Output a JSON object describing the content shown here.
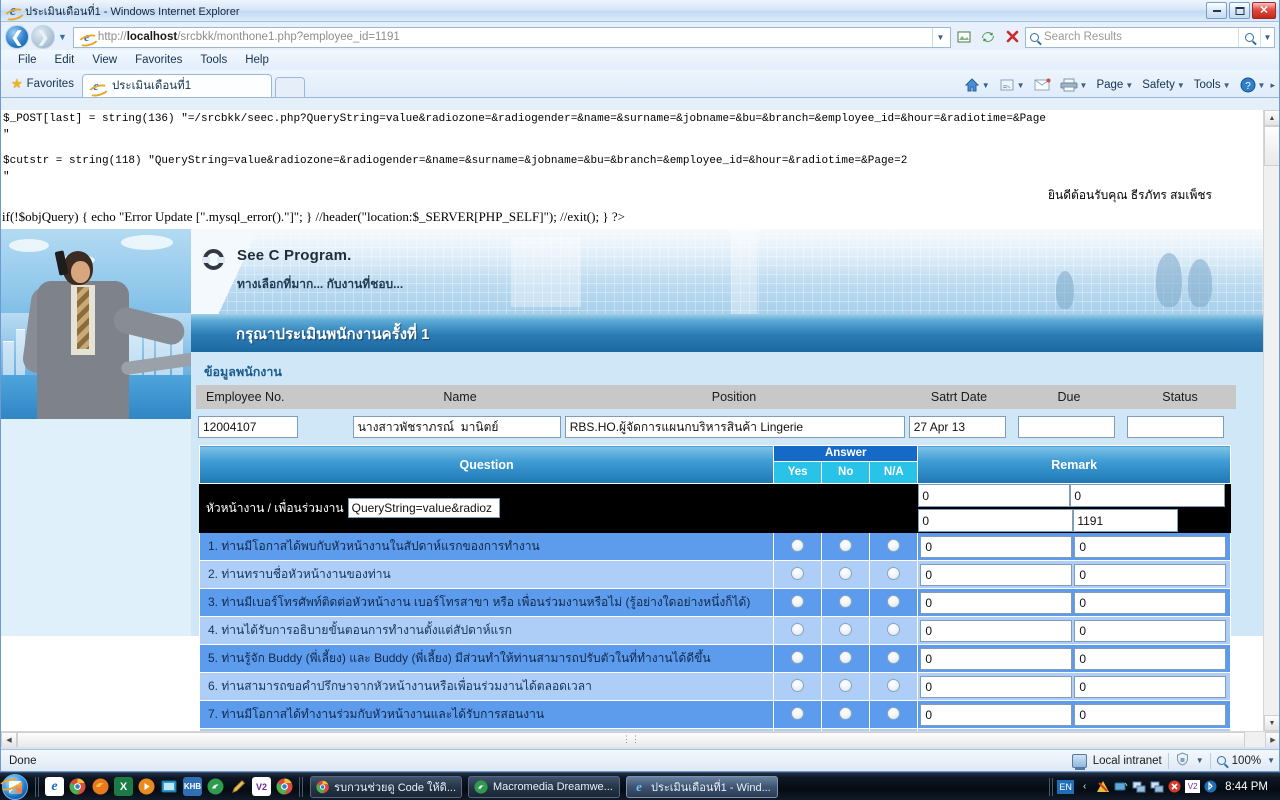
{
  "window": {
    "title": "ประเมินเดือนที่1 - Windows Internet Explorer",
    "minimize_label": "Minimize",
    "maximize_label": "Restore",
    "close_label": "Close"
  },
  "nav": {
    "back_label": "Back",
    "forward_label": "Forward",
    "url_prefix": "http://",
    "url_host": "localhost",
    "url_path": "/srcbkk/monthone1.php?employee_id=1191",
    "refresh_label": "Refresh",
    "stop_label": "Stop",
    "compat_label": "Compatibility View"
  },
  "search": {
    "placeholder": "Search Results",
    "value": ""
  },
  "menubar": {
    "items": [
      "File",
      "Edit",
      "View",
      "Favorites",
      "Tools",
      "Help"
    ]
  },
  "favbar": {
    "favorites_label": "Favorites",
    "tab_title": "ประเมินเดือนที่1",
    "new_tab_label": ""
  },
  "cmdbar": {
    "items": [
      "Page",
      "Safety",
      "Tools"
    ],
    "home_label": "Home",
    "feeds_label": "Feeds",
    "mail_label": "Read mail",
    "print_label": "Print",
    "help_label": "Help"
  },
  "debug": {
    "line1": "$_POST[last] = string(136) \"=/srcbkk/seec.php?QueryString=value&radiozone=&radiogender=&name=&surname=&jobname=&bu=&branch=&employee_id=&hour=&radiotime=&Page",
    "line1b": "\"",
    "line2": "$cutstr = string(118)  \"QueryString=value&radiozone=&radiogender=&name=&surname=&jobname=&bu=&branch=&employee_id=&hour=&radiotime=&Page=2",
    "line2b": "\"",
    "welcome": "ยินดีต้อนรับคุณ ธีรภัทร สมเพ็ชร",
    "line3": "if(!$objQuery) { echo \"Error Update [\".mysql_error().\"]\"; } //header(\"location:$_SERVER[PHP_SELF]\"); //exit(); } ?>"
  },
  "banner": {
    "logo_text": "See C Program.",
    "logo_sub": "ทางเลือกที่มาก... กับงานที่ชอบ...",
    "page_heading": "กรุณาประเมินพนักงานครั้งที่ 1"
  },
  "employee_section": {
    "section_title": "ข้อมูลพนักงาน",
    "columns": [
      "Employee No.",
      "Name",
      "Position",
      "Satrt Date",
      "Due",
      "Status"
    ],
    "values": {
      "employee_no": "12004107",
      "name": "นางสาวพัชราภรณ์  มานิตย์",
      "position": "RBS.HO.ผู้จัดการแผนกบริหารสินค้า Lingerie",
      "start_date": "27 Apr 13",
      "due": "",
      "status": ""
    }
  },
  "question_table": {
    "headers": {
      "question": "Question",
      "answer": "Answer",
      "yes": "Yes",
      "no": "No",
      "na": "N/A",
      "remark": "Remark"
    },
    "black_row": {
      "label": "หัวหน้างาน / เพื่อนร่วมงาน",
      "input_a": "QueryString=value&radioz",
      "input_b": "0",
      "input_c": "0",
      "input_d": "0",
      "input_e": "1191"
    },
    "rows": [
      {
        "text": "1. ท่านมีโอกาสได้พบกับหัวหน้างานในสัปดาห์แรกของการทำงาน",
        "remark1": "0",
        "remark2": "0"
      },
      {
        "text": "2. ท่านทราบชื่อหัวหน้างานของท่าน",
        "remark1": "0",
        "remark2": "0"
      },
      {
        "text": "3. ท่านมีเบอร์โทรศัพท์ติดต่อหัวหน้างาน เบอร์โทรสาขา หรือ เพื่อนร่วมงานหรือไม่ (รู้อย่างใดอย่างหนึ่งก็ได้)",
        "remark1": "0",
        "remark2": "0"
      },
      {
        "text": "4. ท่านได้รับการอธิบายขั้นตอนการทำงานตั้งแต่สัปดาห์แรก",
        "remark1": "0",
        "remark2": "0"
      },
      {
        "text": "5. ท่านรู้จัก Buddy (พี่เลี้ยง) และ Buddy (พี่เลี้ยง) มีส่วนทำให้ท่านสามารถปรับตัวในที่ทำงานได้ดีขึ้น",
        "remark1": "0",
        "remark2": "0"
      },
      {
        "text": "6. ท่านสามารถขอคำปรึกษาจากหัวหน้างานหรือเพื่อนร่วมงานได้ตลอดเวลา",
        "remark1": "0",
        "remark2": "0"
      },
      {
        "text": "7. ท่านมีโอกาสได้ทำงานร่วมกับหัวหน้างานและได้รับการสอนงาน",
        "remark1": "0",
        "remark2": "0"
      }
    ]
  },
  "statusbar": {
    "text": "Done",
    "zone": "Local intranet",
    "zoom": "100%"
  },
  "taskbar": {
    "quicklaunch": [
      "ie-icon",
      "chrome-icon",
      "firefox-icon",
      "excel-icon",
      "media-player-icon",
      "window-icon",
      "khb-icon",
      "dreamweaver-icon",
      "pencil-icon",
      "visual-studio-icon",
      "chrome-icon-2"
    ],
    "tasks": [
      {
        "label": "รบกวนช่วยดู Code ให้ดิ...",
        "icon": "chrome-icon"
      },
      {
        "label": "Macromedia Dreamwe...",
        "icon": "dreamweaver-icon"
      },
      {
        "label": "ประเมินเดือนที่1 - Wind...",
        "icon": "ie-icon"
      }
    ],
    "tray": {
      "language": "EN",
      "clock": "8:44 PM"
    }
  }
}
